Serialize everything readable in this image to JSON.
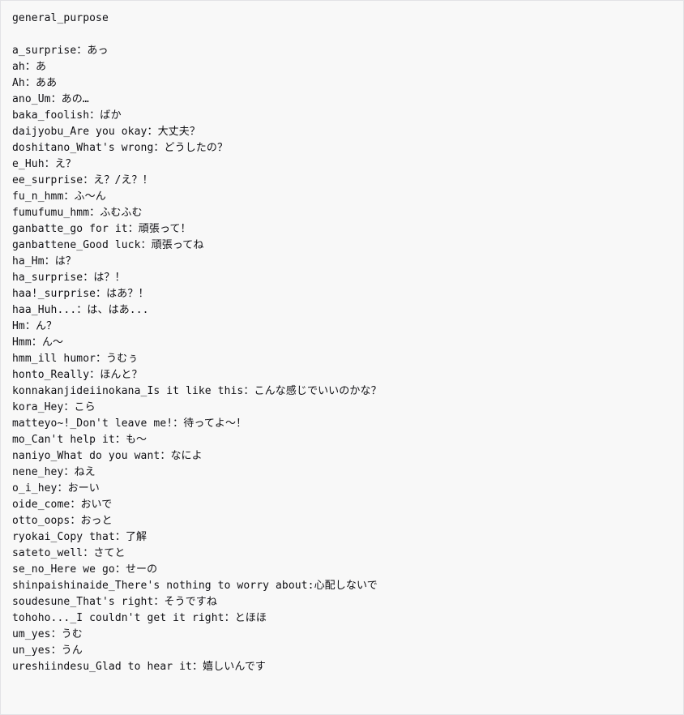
{
  "document": {
    "section_title": "general_purpose",
    "entries": [
      {
        "key": "a_surprise",
        "separator": "：",
        "value": "あっ"
      },
      {
        "key": "ah",
        "separator": "：",
        "value": "あ"
      },
      {
        "key": "Ah",
        "separator": "：",
        "value": "ああ"
      },
      {
        "key": "ano_Um",
        "separator": "：",
        "value": "あの…"
      },
      {
        "key": "baka_foolish",
        "separator": "：",
        "value": "ばか"
      },
      {
        "key": "daijyobu_Are you okay",
        "separator": "：",
        "value": "大丈夫？"
      },
      {
        "key": "doshitano_What's wrong",
        "separator": "：",
        "value": "どうしたの？"
      },
      {
        "key": "e_Huh",
        "separator": "：",
        "value": "え？"
      },
      {
        "key": "ee_surprise",
        "separator": "：",
        "value": "え？/え？！"
      },
      {
        "key": "fu_n_hmm",
        "separator": "：",
        "value": "ふ〜ん"
      },
      {
        "key": "fumufumu_hmm",
        "separator": "：",
        "value": "ふむふむ"
      },
      {
        "key": "ganbatte_go for it",
        "separator": "：",
        "value": "頑張って！"
      },
      {
        "key": "ganbattene_Good luck",
        "separator": "：",
        "value": "頑張ってね"
      },
      {
        "key": "ha_Hm",
        "separator": "：",
        "value": "は？"
      },
      {
        "key": "ha_surprise",
        "separator": "：",
        "value": "は？！"
      },
      {
        "key": "haa!_surprise",
        "separator": "：",
        "value": "はあ？！"
      },
      {
        "key": "haa_Huh...",
        "separator": "：",
        "value": "は、はあ..."
      },
      {
        "key": "Hm",
        "separator": "：",
        "value": "ん？"
      },
      {
        "key": "Hmm",
        "separator": "：",
        "value": "ん〜"
      },
      {
        "key": "hmm_ill humor",
        "separator": "：",
        "value": "うむぅ"
      },
      {
        "key": "honto_Really",
        "separator": "：",
        "value": "ほんと？"
      },
      {
        "key": "konnakanjideiinokana_Is it like this",
        "separator": "：",
        "value": "こんな感じでいいのかな？"
      },
      {
        "key": "kora_Hey",
        "separator": "：",
        "value": "こら"
      },
      {
        "key": "matteyo~!_Don't leave me!",
        "separator": "：",
        "value": "待ってよ〜！"
      },
      {
        "key": "mo_Can't help it",
        "separator": "：",
        "value": "も〜"
      },
      {
        "key": "naniyo_What do you want",
        "separator": "：",
        "value": "なによ"
      },
      {
        "key": "nene_hey",
        "separator": "：",
        "value": "ねえ"
      },
      {
        "key": "o_i_hey",
        "separator": "：",
        "value": "おーい"
      },
      {
        "key": "oide_come",
        "separator": "：",
        "value": "おいで"
      },
      {
        "key": "otto_oops",
        "separator": "：",
        "value": "おっと"
      },
      {
        "key": "ryokai_Copy that",
        "separator": "：",
        "value": "了解"
      },
      {
        "key": "sateto_well",
        "separator": "：",
        "value": "さてと"
      },
      {
        "key": "se_no_Here we go",
        "separator": "：",
        "value": "せーの"
      },
      {
        "key": "shinpaishinaide_There's nothing to worry about",
        "separator": ":",
        "value": "心配しないで"
      },
      {
        "key": "soudesune_That's right",
        "separator": "：",
        "value": "そうですね"
      },
      {
        "key": "tohoho..._I couldn't get it right",
        "separator": "：",
        "value": "とほほ"
      },
      {
        "key": "um_yes",
        "separator": "：",
        "value": "うむ"
      },
      {
        "key": "un_yes",
        "separator": "：",
        "value": "うん"
      },
      {
        "key": "ureshiindesu_Glad to hear it",
        "separator": "：",
        "value": "嬉しいんです"
      }
    ]
  },
  "colors": {
    "background": "#f8f8f8",
    "text": "#101014",
    "border": "#e3e3e6"
  }
}
